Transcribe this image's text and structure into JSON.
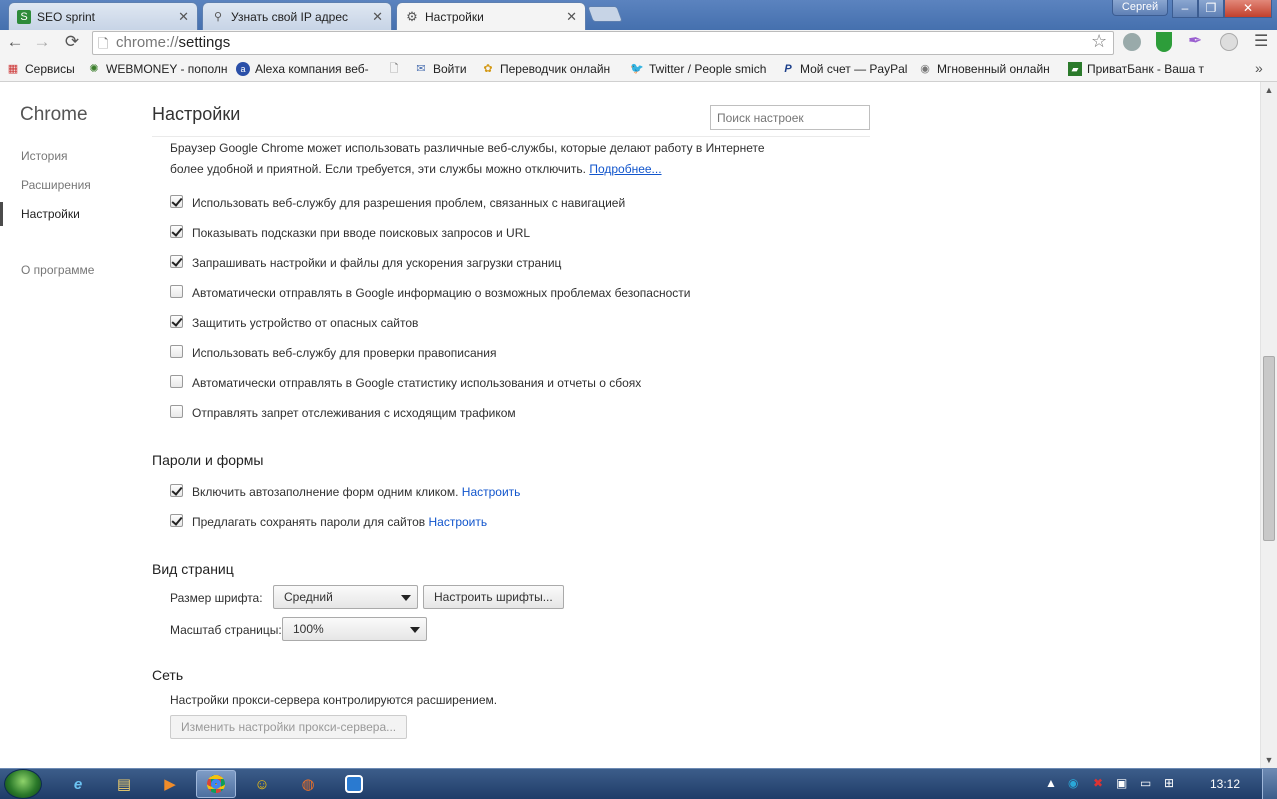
{
  "window": {
    "user": "Сергей",
    "tabs": [
      {
        "title": "SEO sprint",
        "icon": "seosprint-icon"
      },
      {
        "title": "Узнать свой IP адрес",
        "icon": "search-icon"
      },
      {
        "title": "Настройки",
        "icon": "gear-icon"
      }
    ],
    "controls": {
      "minimize": "–",
      "maximize": "❐",
      "close": "✕"
    }
  },
  "toolbar": {
    "url_scheme": "chrome://",
    "url_path": "settings"
  },
  "bookmarks": [
    {
      "label": "Сервисы",
      "icon": "apps-grid-icon"
    },
    {
      "label": "WEBMONEY - пополн",
      "icon": "webmoney-icon"
    },
    {
      "label": "Alexa компания веб-",
      "icon": "alexa-icon"
    },
    {
      "label": "",
      "icon": "page-icon"
    },
    {
      "label": "Войти",
      "icon": "mail-icon"
    },
    {
      "label": "Переводчик онлайн",
      "icon": "translate-icon"
    },
    {
      "label": "Twitter / People smich",
      "icon": "twitter-icon"
    },
    {
      "label": "Мой счет — PayPal",
      "icon": "paypal-icon"
    },
    {
      "label": "Мгновенный онлайн",
      "icon": "globe-icon"
    },
    {
      "label": "ПриватБанк - Ваша т",
      "icon": "privatbank-icon"
    }
  ],
  "leftnav": {
    "title": "Chrome",
    "items": [
      "История",
      "Расширения",
      "Настройки",
      "О программе"
    ],
    "selected": "Настройки"
  },
  "header": {
    "title": "Настройки",
    "search_placeholder": "Поиск настроек"
  },
  "privacy": {
    "intro_line1": "Браузер Google Chrome может использовать различные веб-службы, которые делают работу в Интернете",
    "intro_line2": "более удобной и приятной. Если требуется, эти службы можно отключить.",
    "more_link": "Подробнее...",
    "options": [
      {
        "label": "Использовать веб-службу для разрешения проблем, связанных с навигацией",
        "checked": true
      },
      {
        "label": "Показывать подсказки при вводе поисковых запросов и URL",
        "checked": true
      },
      {
        "label": "Запрашивать настройки и файлы для ускорения загрузки страниц",
        "checked": true
      },
      {
        "label": "Автоматически отправлять в Google информацию о возможных проблемах безопасности",
        "checked": false
      },
      {
        "label": "Защитить устройство от опасных сайтов",
        "checked": true
      },
      {
        "label": "Использовать веб-службу для проверки правописания",
        "checked": false
      },
      {
        "label": "Автоматически отправлять в Google статистику использования и отчеты о сбоях",
        "checked": false
      },
      {
        "label": "Отправлять запрет отслеживания с исходящим трафиком",
        "checked": false
      }
    ]
  },
  "passwords": {
    "title": "Пароли и формы",
    "options": [
      {
        "label": "Включить автозаполнение форм одним кликом.",
        "link": "Настроить",
        "checked": true
      },
      {
        "label": "Предлагать сохранять пароли для сайтов",
        "link": "Настроить",
        "checked": true
      }
    ]
  },
  "appearance": {
    "title": "Вид страниц",
    "font_size_label": "Размер шрифта:",
    "font_size_value": "Средний",
    "customize_fonts": "Настроить шрифты...",
    "zoom_label": "Масштаб страницы:",
    "zoom_value": "100%"
  },
  "network": {
    "title": "Сеть",
    "text": "Настройки прокси-сервера контролируются расширением.",
    "button": "Изменить настройки прокси-сервера..."
  },
  "taskbar": {
    "clock": "13:12"
  }
}
